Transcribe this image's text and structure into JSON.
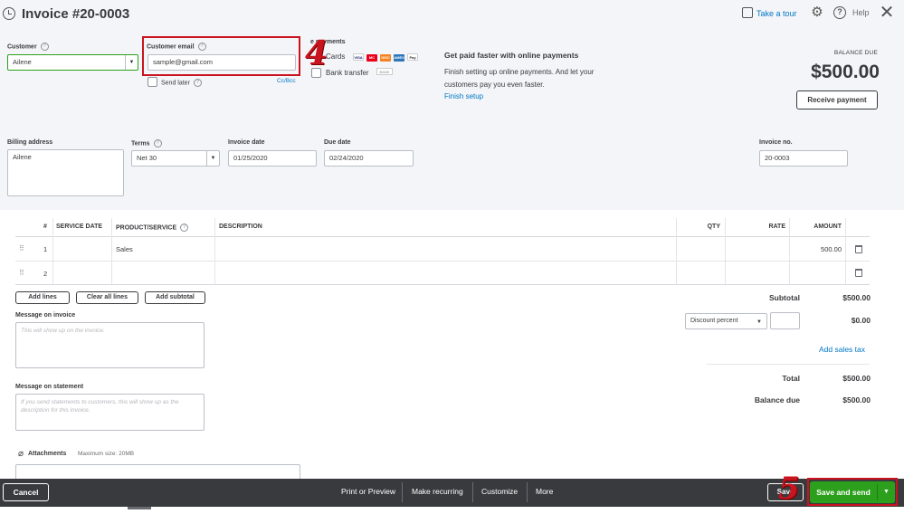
{
  "header": {
    "title": "Invoice #20-0003",
    "take_tour": "Take a tour",
    "help": "Help"
  },
  "customer": {
    "label": "Customer",
    "value": "Ailene"
  },
  "email": {
    "label": "Customer email",
    "value": "sample@gmail.com",
    "send_later": "Send later",
    "cc_bcc": "Cc/Bcc"
  },
  "payments": {
    "label": "Online payments",
    "label_visible": "e payments",
    "cards": "Cards",
    "bank_transfer": "Bank transfer",
    "card_brands": [
      "VISA",
      "MC",
      "DISC",
      "AMEX",
      "Pay"
    ],
    "bank_badge": "BANK"
  },
  "promo": {
    "title": "Get paid faster with online payments",
    "text": "Finish setting up online payments. And let your customers pay you even faster.",
    "link": "Finish setup"
  },
  "balance": {
    "label": "BALANCE DUE",
    "amount": "$500.00",
    "receive_button": "Receive payment"
  },
  "billing": {
    "label": "Billing address",
    "value": "Ailene"
  },
  "terms": {
    "label": "Terms",
    "value": "Net 30"
  },
  "invoice_date": {
    "label": "Invoice date",
    "value": "01/25/2020"
  },
  "due_date": {
    "label": "Due date",
    "value": "02/24/2020"
  },
  "invoice_no": {
    "label": "Invoice no.",
    "value": "20-0003"
  },
  "table": {
    "headers": [
      "#",
      "SERVICE DATE",
      "PRODUCT/SERVICE",
      "DESCRIPTION",
      "QTY",
      "RATE",
      "AMOUNT"
    ],
    "rows": [
      {
        "num": "1",
        "service_date": "",
        "product": "Sales",
        "description": "",
        "qty": "",
        "rate": "",
        "amount": "500.00"
      },
      {
        "num": "2",
        "service_date": "",
        "product": "",
        "description": "",
        "qty": "",
        "rate": "",
        "amount": ""
      }
    ]
  },
  "table_buttons": {
    "add_lines": "Add lines",
    "clear_all": "Clear all lines",
    "add_subtotal": "Add subtotal"
  },
  "message_invoice": {
    "label": "Message on invoice",
    "placeholder": "This will show up on the invoice."
  },
  "message_statement": {
    "label": "Message on statement",
    "placeholder": "If you send statements to customers, this will show up as the description for this invoice."
  },
  "attachments": {
    "label": "Attachments",
    "max_size": "Maximum size: 20MB"
  },
  "totals": {
    "subtotal_label": "Subtotal",
    "subtotal_value": "$500.00",
    "discount_select": "Discount percent",
    "discount_value": "$0.00",
    "add_sales_tax": "Add sales tax",
    "total_label": "Total",
    "total_value": "$500.00",
    "balance_label": "Balance due",
    "balance_value": "$500.00"
  },
  "footer": {
    "cancel": "Cancel",
    "print_preview": "Print or Preview",
    "make_recurring": "Make recurring",
    "customize": "Customize",
    "more": "More",
    "save": "Save",
    "save_and_send": "Save and send"
  },
  "annotations": {
    "step4": "4",
    "step5": "5"
  },
  "colors": {
    "accent_green": "#2ca01c",
    "link_blue": "#0077c5",
    "highlight_red": "#c9141f",
    "footer_bg": "#393a3d"
  }
}
